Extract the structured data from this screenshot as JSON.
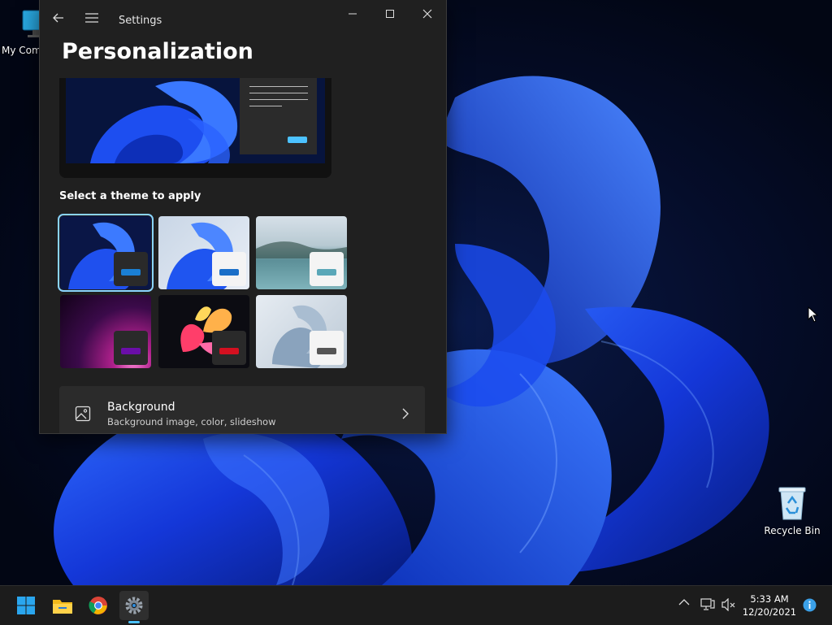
{
  "desktop": {
    "icons": [
      {
        "label": "My Com"
      },
      {
        "label": "Recycle Bin"
      }
    ]
  },
  "window": {
    "app_title": "Settings",
    "page_title": "Personalization",
    "theme_section_heading": "Select a theme to apply",
    "themes": [
      {
        "accent": "#1a7fd4",
        "selected": true
      },
      {
        "accent": "#1a6fc8"
      },
      {
        "accent": "#5aa7b8"
      },
      {
        "accent": "#6a0ea8"
      },
      {
        "accent": "#d41020"
      },
      {
        "accent": "#555555"
      }
    ],
    "background_row": {
      "title": "Background",
      "subtitle": "Background image, color, slideshow"
    },
    "accent_color": "#4cc2ff"
  },
  "taskbar": {
    "apps": [
      {
        "icon": "windows-start-icon"
      },
      {
        "icon": "file-explorer-icon"
      },
      {
        "icon": "chrome-icon"
      },
      {
        "icon": "settings-gear-icon",
        "active": true
      }
    ],
    "clock_time": "5:33 AM",
    "clock_date": "12/20/2021"
  }
}
